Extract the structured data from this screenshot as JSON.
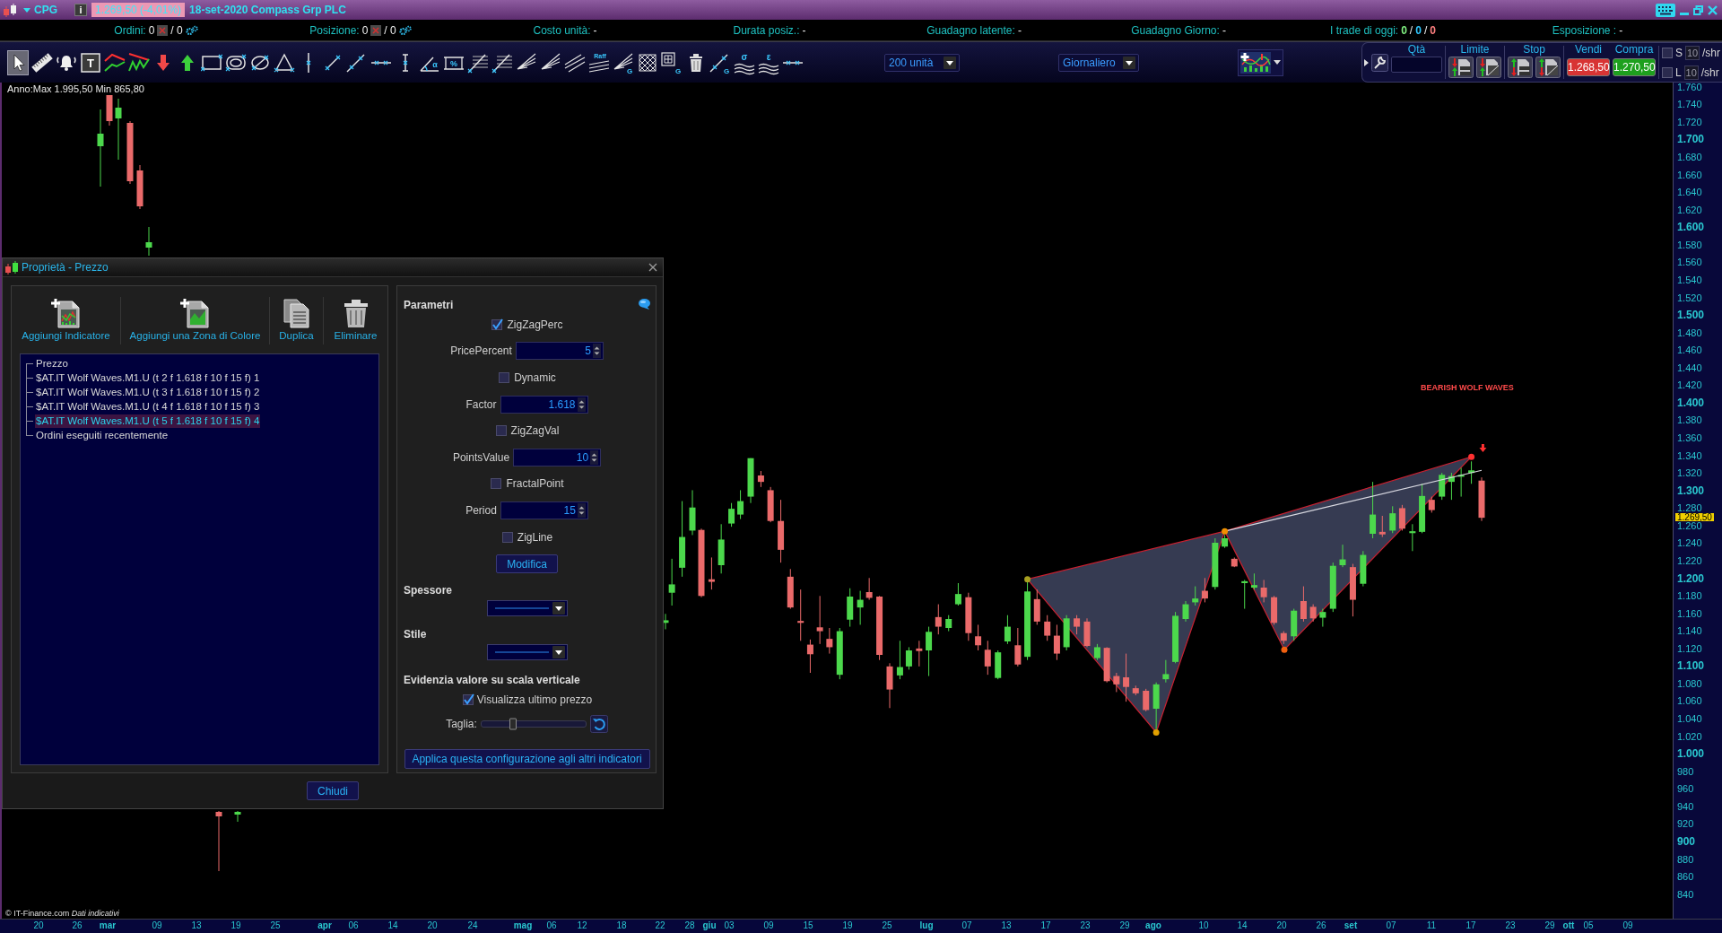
{
  "title_bar": {
    "symbol": "CPG",
    "info_button": "i",
    "price_change": "1.269,50 (-4,01%)",
    "title": "18-set-2020 Compass Grp PLC"
  },
  "status_bar": [
    {
      "kind": "orders",
      "label": "Ordini:",
      "value": "0",
      "total": "/ 0"
    },
    {
      "kind": "orders",
      "label": "Posizione:",
      "value": "0",
      "total": "/ 0"
    },
    {
      "kind": "plain",
      "label": "Costo unità:",
      "value": "-"
    },
    {
      "kind": "plain",
      "label": "Durata posiz.:",
      "value": "-"
    },
    {
      "kind": "plain",
      "label": "Guadagno latente:",
      "value": "-"
    },
    {
      "kind": "plain",
      "label": "Guadagno Giorno:",
      "value": "-"
    },
    {
      "kind": "counts",
      "label": "I trade di oggi:",
      "counts": [
        {
          "value": "0",
          "color": "#80f080"
        },
        {
          "value": "0",
          "color": "#30c8ff"
        },
        {
          "value": "0",
          "color": "#ff8080"
        }
      ],
      "separators": [
        "/",
        "/"
      ]
    },
    {
      "kind": "plain",
      "label": "Esposizione :",
      "value": "-"
    }
  ],
  "drawing_tools": [
    {
      "kind": "pointer",
      "selected": true
    },
    {
      "kind": "ruler",
      "selected": false
    },
    {
      "kind": "bell",
      "selected": false
    },
    {
      "kind": "textbox",
      "label": "T",
      "selected": false
    },
    {
      "kind": "trendlines",
      "selected": false
    },
    {
      "kind": "zigzag",
      "selected": false
    },
    {
      "kind": "arrow-down",
      "selected": false
    },
    {
      "kind": "arrow-up",
      "selected": false
    },
    {
      "kind": "rectangle",
      "selected": false
    },
    {
      "kind": "ellipse",
      "selected": false
    },
    {
      "kind": "circle",
      "selected": false
    },
    {
      "kind": "triangle",
      "selected": false
    },
    {
      "kind": "vline",
      "selected": false
    },
    {
      "kind": "segment",
      "selected": false
    },
    {
      "kind": "line",
      "selected": false
    },
    {
      "kind": "hline",
      "selected": false
    },
    {
      "kind": "vmeasure",
      "selected": false
    },
    {
      "kind": "angle",
      "label": "α",
      "selected": false
    },
    {
      "kind": "percent",
      "label": "%",
      "selected": false
    },
    {
      "kind": "fibo",
      "selected": false
    },
    {
      "kind": "fibo",
      "selected": false
    },
    {
      "kind": "fan",
      "selected": false
    },
    {
      "kind": "fan",
      "selected": false
    },
    {
      "kind": "parallel",
      "selected": false
    },
    {
      "kind": "raff",
      "label": "Raff",
      "selected": false
    },
    {
      "kind": "fan",
      "label": "G",
      "selected": false
    },
    {
      "kind": "grid",
      "selected": false
    },
    {
      "kind": "box",
      "label": "G",
      "selected": false
    },
    {
      "kind": "trash",
      "selected": false
    },
    {
      "kind": "line",
      "label": "G",
      "selected": false
    },
    {
      "kind": "bands",
      "label": "σ",
      "selected": false
    },
    {
      "kind": "bands",
      "label": "ε",
      "selected": false
    },
    {
      "kind": "hline",
      "selected": false
    }
  ],
  "quantity_select": {
    "value": "200 unità"
  },
  "period_select": {
    "value": "Giornaliero"
  },
  "order_panel": {
    "quantity": {
      "label": "Qtà"
    },
    "limit": {
      "label": "Limite"
    },
    "stop": {
      "label": "Stop"
    },
    "sell": {
      "label": "Vendi",
      "price": "1.268,50"
    },
    "buy": {
      "label": "Compra",
      "price": "1.270,50"
    },
    "share_limits": [
      {
        "label": "S",
        "checked": false,
        "value": "10",
        "disabled": true,
        "unit": "/shr"
      },
      {
        "label": "L",
        "checked": false,
        "value": "10",
        "disabled": true,
        "unit": "/shr"
      }
    ]
  },
  "chart": {
    "range_note": "Anno:Max 1.995,50 Min 865,80",
    "pattern_label": "BEARISH WOLF WAVES",
    "last_price": "1.269,50",
    "credit": "© IT-Finance.com *Dati indicativi*",
    "price_axis": [
      {
        "label": "1.760",
        "major": false
      },
      {
        "label": "1.740",
        "major": false
      },
      {
        "label": "1.720",
        "major": false
      },
      {
        "label": "1.700",
        "major": true
      },
      {
        "label": "1.680",
        "major": false
      },
      {
        "label": "1.660",
        "major": false
      },
      {
        "label": "1.640",
        "major": false
      },
      {
        "label": "1.620",
        "major": false
      },
      {
        "label": "1.600",
        "major": true
      },
      {
        "label": "1.580",
        "major": false
      },
      {
        "label": "1.560",
        "major": false
      },
      {
        "label": "1.540",
        "major": false
      },
      {
        "label": "1.520",
        "major": false
      },
      {
        "label": "1.500",
        "major": true
      },
      {
        "label": "1.480",
        "major": false
      },
      {
        "label": "1.460",
        "major": false
      },
      {
        "label": "1.440",
        "major": false
      },
      {
        "label": "1.420",
        "major": false
      },
      {
        "label": "1.400",
        "major": true
      },
      {
        "label": "1.380",
        "major": false
      },
      {
        "label": "1.360",
        "major": false
      },
      {
        "label": "1.340",
        "major": false
      },
      {
        "label": "1.320",
        "major": false
      },
      {
        "label": "1.300",
        "major": true
      },
      {
        "label": "1.280",
        "major": false
      },
      {
        "label": "1.260",
        "major": false
      },
      {
        "label": "1.240",
        "major": false
      },
      {
        "label": "1.220",
        "major": false
      },
      {
        "label": "1.200",
        "major": true
      },
      {
        "label": "1.180",
        "major": false
      },
      {
        "label": "1.160",
        "major": false
      },
      {
        "label": "1.140",
        "major": false
      },
      {
        "label": "1.120",
        "major": false
      },
      {
        "label": "1.100",
        "major": true
      },
      {
        "label": "1.080",
        "major": false
      },
      {
        "label": "1.060",
        "major": false
      },
      {
        "label": "1.040",
        "major": false
      },
      {
        "label": "1.020",
        "major": false
      },
      {
        "label": "1.000",
        "major": true
      },
      {
        "label": "980",
        "major": false
      },
      {
        "label": "960",
        "major": false
      },
      {
        "label": "940",
        "major": false
      },
      {
        "label": "920",
        "major": false
      },
      {
        "label": "900",
        "major": true
      },
      {
        "label": "880",
        "major": false
      },
      {
        "label": "860",
        "major": false
      },
      {
        "label": "840",
        "major": false
      }
    ],
    "date_axis": [
      {
        "label": "20",
        "month": false
      },
      {
        "label": "26",
        "month": false
      },
      {
        "label": "mar",
        "month": true
      },
      {
        "label": "09",
        "month": false
      },
      {
        "label": "13",
        "month": false
      },
      {
        "label": "19",
        "month": false
      },
      {
        "label": "25",
        "month": false
      },
      {
        "label": "apr",
        "month": true
      },
      {
        "label": "06",
        "month": false
      },
      {
        "label": "14",
        "month": false
      },
      {
        "label": "20",
        "month": false
      },
      {
        "label": "24",
        "month": false
      },
      {
        "label": "mag",
        "month": true
      },
      {
        "label": "06",
        "month": false
      },
      {
        "label": "12",
        "month": false
      },
      {
        "label": "18",
        "month": false
      },
      {
        "label": "22",
        "month": false
      },
      {
        "label": "28",
        "month": false
      },
      {
        "label": "giu",
        "month": true
      },
      {
        "label": "03",
        "month": false
      },
      {
        "label": "09",
        "month": false
      },
      {
        "label": "15",
        "month": false
      },
      {
        "label": "19",
        "month": false
      },
      {
        "label": "25",
        "month": false
      },
      {
        "label": "lug",
        "month": true
      },
      {
        "label": "07",
        "month": false
      },
      {
        "label": "13",
        "month": false
      },
      {
        "label": "17",
        "month": false
      },
      {
        "label": "23",
        "month": false
      },
      {
        "label": "29",
        "month": false
      },
      {
        "label": "ago",
        "month": true
      },
      {
        "label": "10",
        "month": false
      },
      {
        "label": "14",
        "month": false
      },
      {
        "label": "20",
        "month": false
      },
      {
        "label": "26",
        "month": false
      },
      {
        "label": "set",
        "month": true
      },
      {
        "label": "07",
        "month": false
      },
      {
        "label": "11",
        "month": false
      },
      {
        "label": "17",
        "month": false
      },
      {
        "label": "23",
        "month": false
      },
      {
        "label": "29",
        "month": false
      },
      {
        "label": "ott",
        "month": true
      },
      {
        "label": "05",
        "month": false
      },
      {
        "label": "09",
        "month": false
      }
    ]
  },
  "dialog": {
    "title": "Proprietà - Prezzo",
    "actions": [
      {
        "kind": "add-indicator",
        "label": "Aggiungi Indicatore"
      },
      {
        "kind": "add-zone",
        "label": "Aggiungi una Zona di Colore"
      },
      {
        "kind": "duplicate",
        "label": "Duplica"
      },
      {
        "kind": "delete",
        "label": "Eliminare"
      }
    ],
    "tree": [
      {
        "label": "Prezzo",
        "selected": false
      },
      {
        "label": "$AT.IT Wolf Waves.M1.U (t 2 f 1.618 f 10 f 15 f) 1",
        "selected": false
      },
      {
        "label": "$AT.IT Wolf Waves.M1.U (t 3 f 1.618 f 10 f 15 f) 2",
        "selected": false
      },
      {
        "label": "$AT.IT Wolf Waves.M1.U (t 4 f 1.618 f 10 f 15 f) 3",
        "selected": false
      },
      {
        "label": "$AT.IT Wolf Waves.M1.U (t 5 f 1.618 f 10 f 15 f) 4",
        "selected": true
      },
      {
        "label": "Ordini eseguiti recentemente",
        "selected": false
      }
    ],
    "parameters_title": "Parametri",
    "parameters": [
      {
        "kind": "checkbox",
        "label": "ZigZagPerc",
        "checked": true
      },
      {
        "kind": "number",
        "label": "PricePercent",
        "value": "5"
      },
      {
        "kind": "checkbox",
        "label": "Dynamic",
        "checked": false
      },
      {
        "kind": "number",
        "label": "Factor",
        "value": "1.618"
      },
      {
        "kind": "checkbox",
        "label": "ZigZagVal",
        "checked": false
      },
      {
        "kind": "number",
        "label": "PointsValue",
        "value": "10"
      },
      {
        "kind": "checkbox",
        "label": "FractalPoint",
        "checked": false
      },
      {
        "kind": "number",
        "label": "Period",
        "value": "15"
      },
      {
        "kind": "checkbox",
        "label": "ZigLine",
        "checked": false
      }
    ],
    "modify_button": "Modifica",
    "thickness_label": "Spessore",
    "style_label": "Stile",
    "highlight_title": "Evidenzia valore su scala verticale",
    "show_last_price": {
      "label": "Visualizza ultimo prezzo",
      "checked": true
    },
    "size": {
      "label": "Taglia:",
      "level": 0.3
    },
    "apply_all_button": "Applica questa configurazione agli altri indicatori",
    "close_button": "Chiudi"
  }
}
